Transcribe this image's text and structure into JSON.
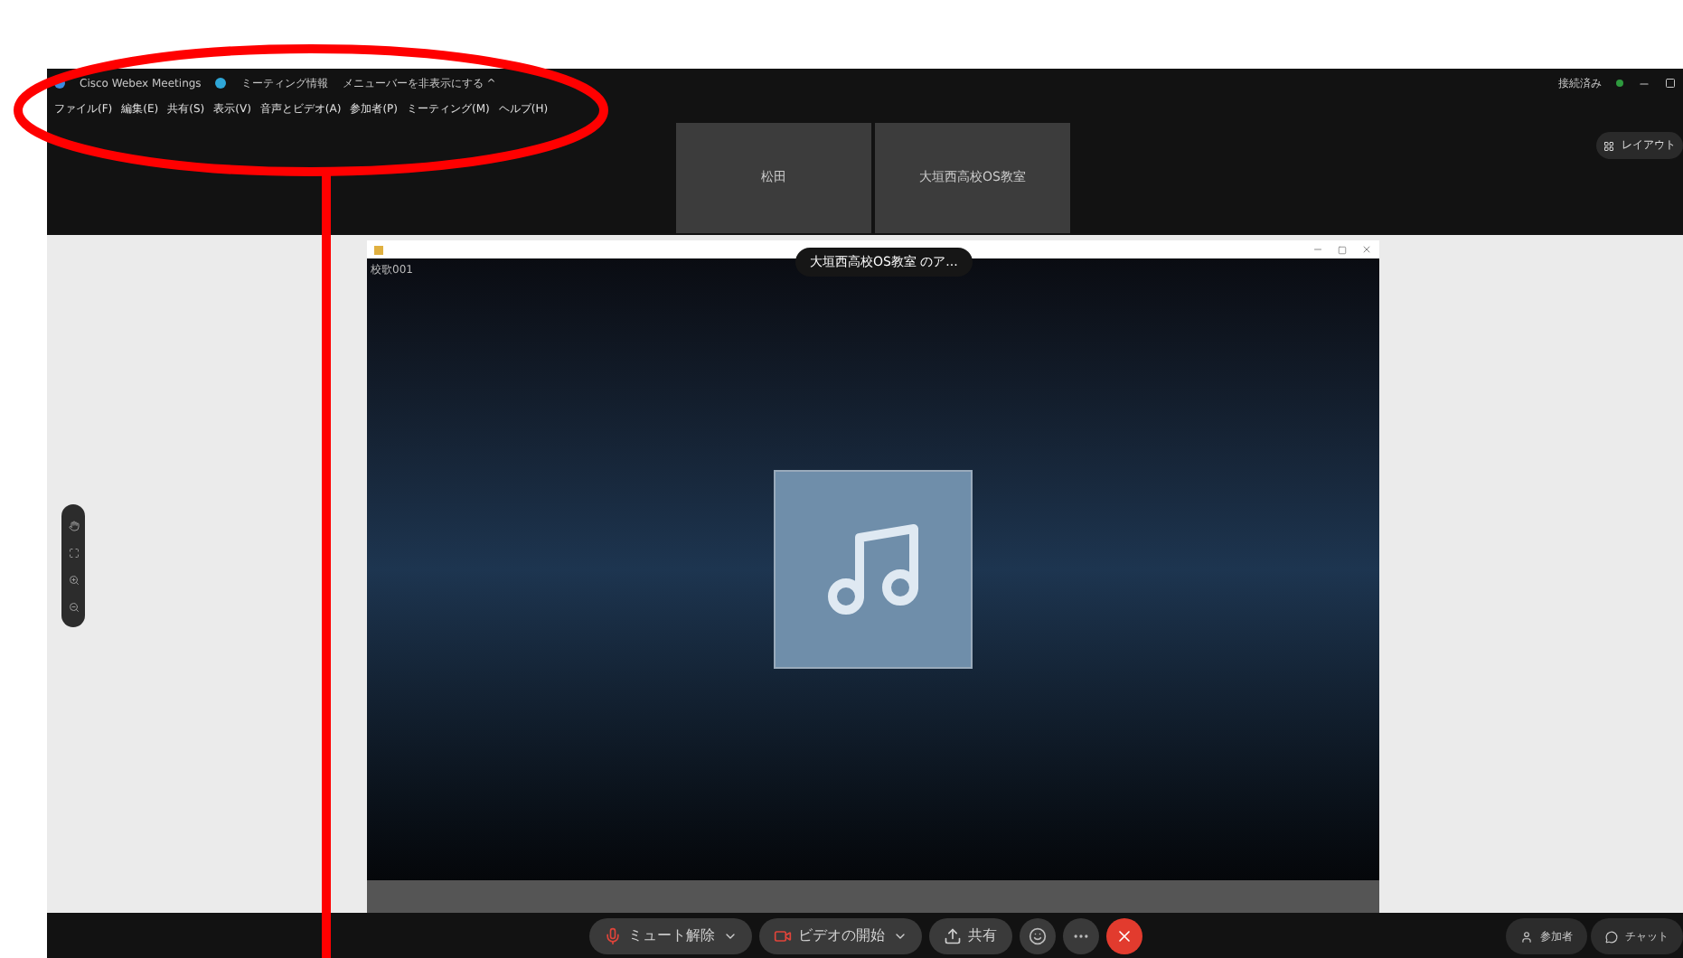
{
  "title_bar": {
    "app": "Cisco Webex Meetings",
    "meeting_info": "ミーティング情報",
    "hide_menu": "メニューバーを非表示にする ^",
    "status": "接続済み"
  },
  "menu": [
    "ファイル(F)",
    "編集(E)",
    "共有(S)",
    "表示(V)",
    "音声とビデオ(A)",
    "参加者(P)",
    "ミーティング(M)",
    "ヘルプ(H)"
  ],
  "participants": [
    {
      "name": "松田"
    },
    {
      "name": "大垣西高校OS教室"
    }
  ],
  "layout_button": "レイアウト",
  "shared_window": {
    "banner": "大垣西高校OS教室 のア...",
    "title": "校歌001"
  },
  "controls": [
    {
      "kind": "split",
      "label": "ミュート解除"
    },
    {
      "kind": "split",
      "label": "ビデオの開始"
    },
    {
      "kind": "plain",
      "label": "共有"
    },
    {
      "kind": "round"
    },
    {
      "kind": "round"
    },
    {
      "kind": "end"
    }
  ],
  "panels": [
    "参加者",
    "チャット"
  ]
}
